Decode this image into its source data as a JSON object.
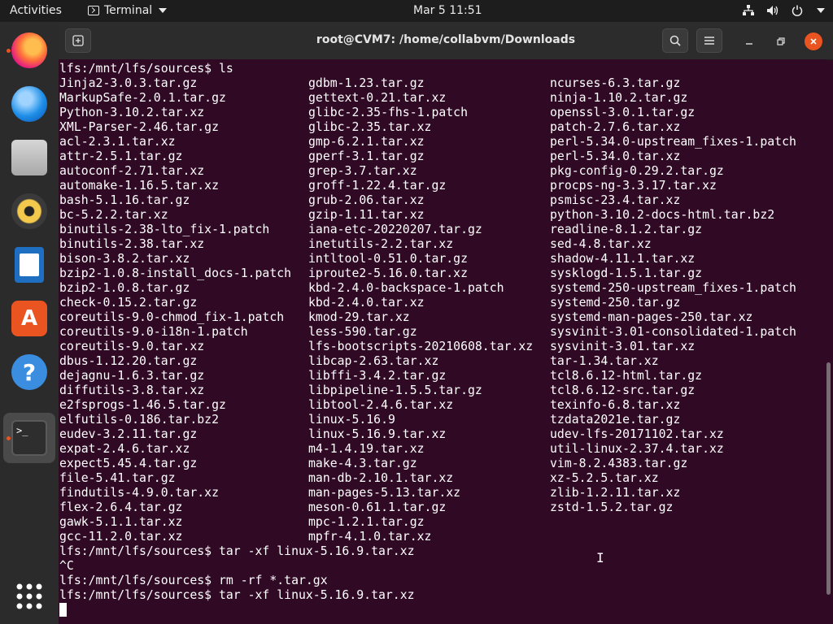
{
  "topbar": {
    "activities": "Activities",
    "app_name": "Terminal",
    "clock": "Mar 5  11:51"
  },
  "dock": {
    "items": [
      "firefox-icon",
      "thunderbird-icon",
      "files-icon",
      "rhythmbox-icon",
      "writer-icon",
      "software-icon",
      "help-icon",
      "terminal-icon",
      "apps-grid-icon"
    ]
  },
  "window": {
    "title": "root@CVM7: /home/collabvm/Downloads"
  },
  "terminal": {
    "prompt_ls": "lfs:/mnt/lfs/sources$ ls",
    "files": {
      "col1": [
        "Jinja2-3.0.3.tar.gz",
        "MarkupSafe-2.0.1.tar.gz",
        "Python-3.10.2.tar.xz",
        "XML-Parser-2.46.tar.gz",
        "acl-2.3.1.tar.xz",
        "attr-2.5.1.tar.gz",
        "autoconf-2.71.tar.xz",
        "automake-1.16.5.tar.xz",
        "bash-5.1.16.tar.gz",
        "bc-5.2.2.tar.xz",
        "binutils-2.38-lto_fix-1.patch",
        "binutils-2.38.tar.xz",
        "bison-3.8.2.tar.xz",
        "bzip2-1.0.8-install_docs-1.patch",
        "bzip2-1.0.8.tar.gz",
        "check-0.15.2.tar.gz",
        "coreutils-9.0-chmod_fix-1.patch",
        "coreutils-9.0-i18n-1.patch",
        "coreutils-9.0.tar.xz",
        "dbus-1.12.20.tar.gz",
        "dejagnu-1.6.3.tar.gz",
        "diffutils-3.8.tar.xz",
        "e2fsprogs-1.46.5.tar.gz",
        "elfutils-0.186.tar.bz2",
        "eudev-3.2.11.tar.gz",
        "expat-2.4.6.tar.xz",
        "expect5.45.4.tar.gz",
        "file-5.41.tar.gz",
        "findutils-4.9.0.tar.xz",
        "flex-2.6.4.tar.gz",
        "gawk-5.1.1.tar.xz",
        "gcc-11.2.0.tar.xz"
      ],
      "col2": [
        "gdbm-1.23.tar.gz",
        "gettext-0.21.tar.xz",
        "glibc-2.35-fhs-1.patch",
        "glibc-2.35.tar.xz",
        "gmp-6.2.1.tar.xz",
        "gperf-3.1.tar.gz",
        "grep-3.7.tar.xz",
        "groff-1.22.4.tar.gz",
        "grub-2.06.tar.xz",
        "gzip-1.11.tar.xz",
        "iana-etc-20220207.tar.gz",
        "inetutils-2.2.tar.xz",
        "intltool-0.51.0.tar.gz",
        "iproute2-5.16.0.tar.xz",
        "kbd-2.4.0-backspace-1.patch",
        "kbd-2.4.0.tar.xz",
        "kmod-29.tar.xz",
        "less-590.tar.gz",
        "lfs-bootscripts-20210608.tar.xz",
        "libcap-2.63.tar.xz",
        "libffi-3.4.2.tar.gz",
        "libpipeline-1.5.5.tar.gz",
        "libtool-2.4.6.tar.xz",
        "linux-5.16.9",
        "linux-5.16.9.tar.xz",
        "m4-1.4.19.tar.xz",
        "make-4.3.tar.gz",
        "man-db-2.10.1.tar.xz",
        "man-pages-5.13.tar.xz",
        "meson-0.61.1.tar.gz",
        "mpc-1.2.1.tar.gz",
        "mpfr-4.1.0.tar.xz"
      ],
      "col3": [
        "ncurses-6.3.tar.gz",
        "ninja-1.10.2.tar.gz",
        "openssl-3.0.1.tar.gz",
        "patch-2.7.6.tar.xz",
        "perl-5.34.0-upstream_fixes-1.patch",
        "perl-5.34.0.tar.xz",
        "pkg-config-0.29.2.tar.gz",
        "procps-ng-3.3.17.tar.xz",
        "psmisc-23.4.tar.xz",
        "python-3.10.2-docs-html.tar.bz2",
        "readline-8.1.2.tar.gz",
        "sed-4.8.tar.xz",
        "shadow-4.11.1.tar.xz",
        "sysklogd-1.5.1.tar.gz",
        "systemd-250-upstream_fixes-1.patch",
        "systemd-250.tar.gz",
        "systemd-man-pages-250.tar.xz",
        "sysvinit-3.01-consolidated-1.patch",
        "sysvinit-3.01.tar.xz",
        "tar-1.34.tar.xz",
        "tcl8.6.12-html.tar.gz",
        "tcl8.6.12-src.tar.gz",
        "texinfo-6.8.tar.xz",
        "tzdata2021e.tar.gz",
        "udev-lfs-20171102.tar.xz",
        "util-linux-2.37.4.tar.xz",
        "vim-8.2.4383.tar.gz",
        "xz-5.2.5.tar.xz",
        "zlib-1.2.11.tar.xz",
        "zstd-1.5.2.tar.gz"
      ]
    },
    "cmd1": "lfs:/mnt/lfs/sources$ tar -xf linux-5.16.9.tar.xz",
    "interrupt": "^C",
    "cmd2": "lfs:/mnt/lfs/sources$ rm -rf *.tar.gx",
    "cmd3": "lfs:/mnt/lfs/sources$ tar -xf linux-5.16.9.tar.xz"
  }
}
